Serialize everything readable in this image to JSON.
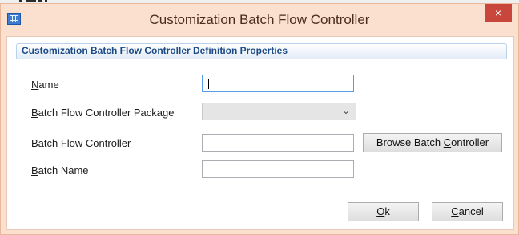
{
  "window": {
    "title": "Customization Batch Flow Controller",
    "close_glyph": "×",
    "app_icon": "table-grid-icon"
  },
  "group": {
    "title": "Customization Batch Flow Controller Definition Properties"
  },
  "fields": {
    "name": {
      "accel": "N",
      "rest": "ame",
      "value": ""
    },
    "package": {
      "accel": "B",
      "rest": "atch Flow Controller Package",
      "selected": ""
    },
    "controller": {
      "accel": "B",
      "rest": "atch Flow Controller",
      "value": ""
    },
    "batch_name": {
      "accel": "B",
      "rest": "atch Name",
      "value": ""
    }
  },
  "buttons": {
    "browse": {
      "pre": "Browse Batch ",
      "accel": "C",
      "post": "ontroller"
    },
    "ok": {
      "accel": "O",
      "post": "k"
    },
    "cancel": {
      "accel": "C",
      "post": "ancel"
    }
  }
}
